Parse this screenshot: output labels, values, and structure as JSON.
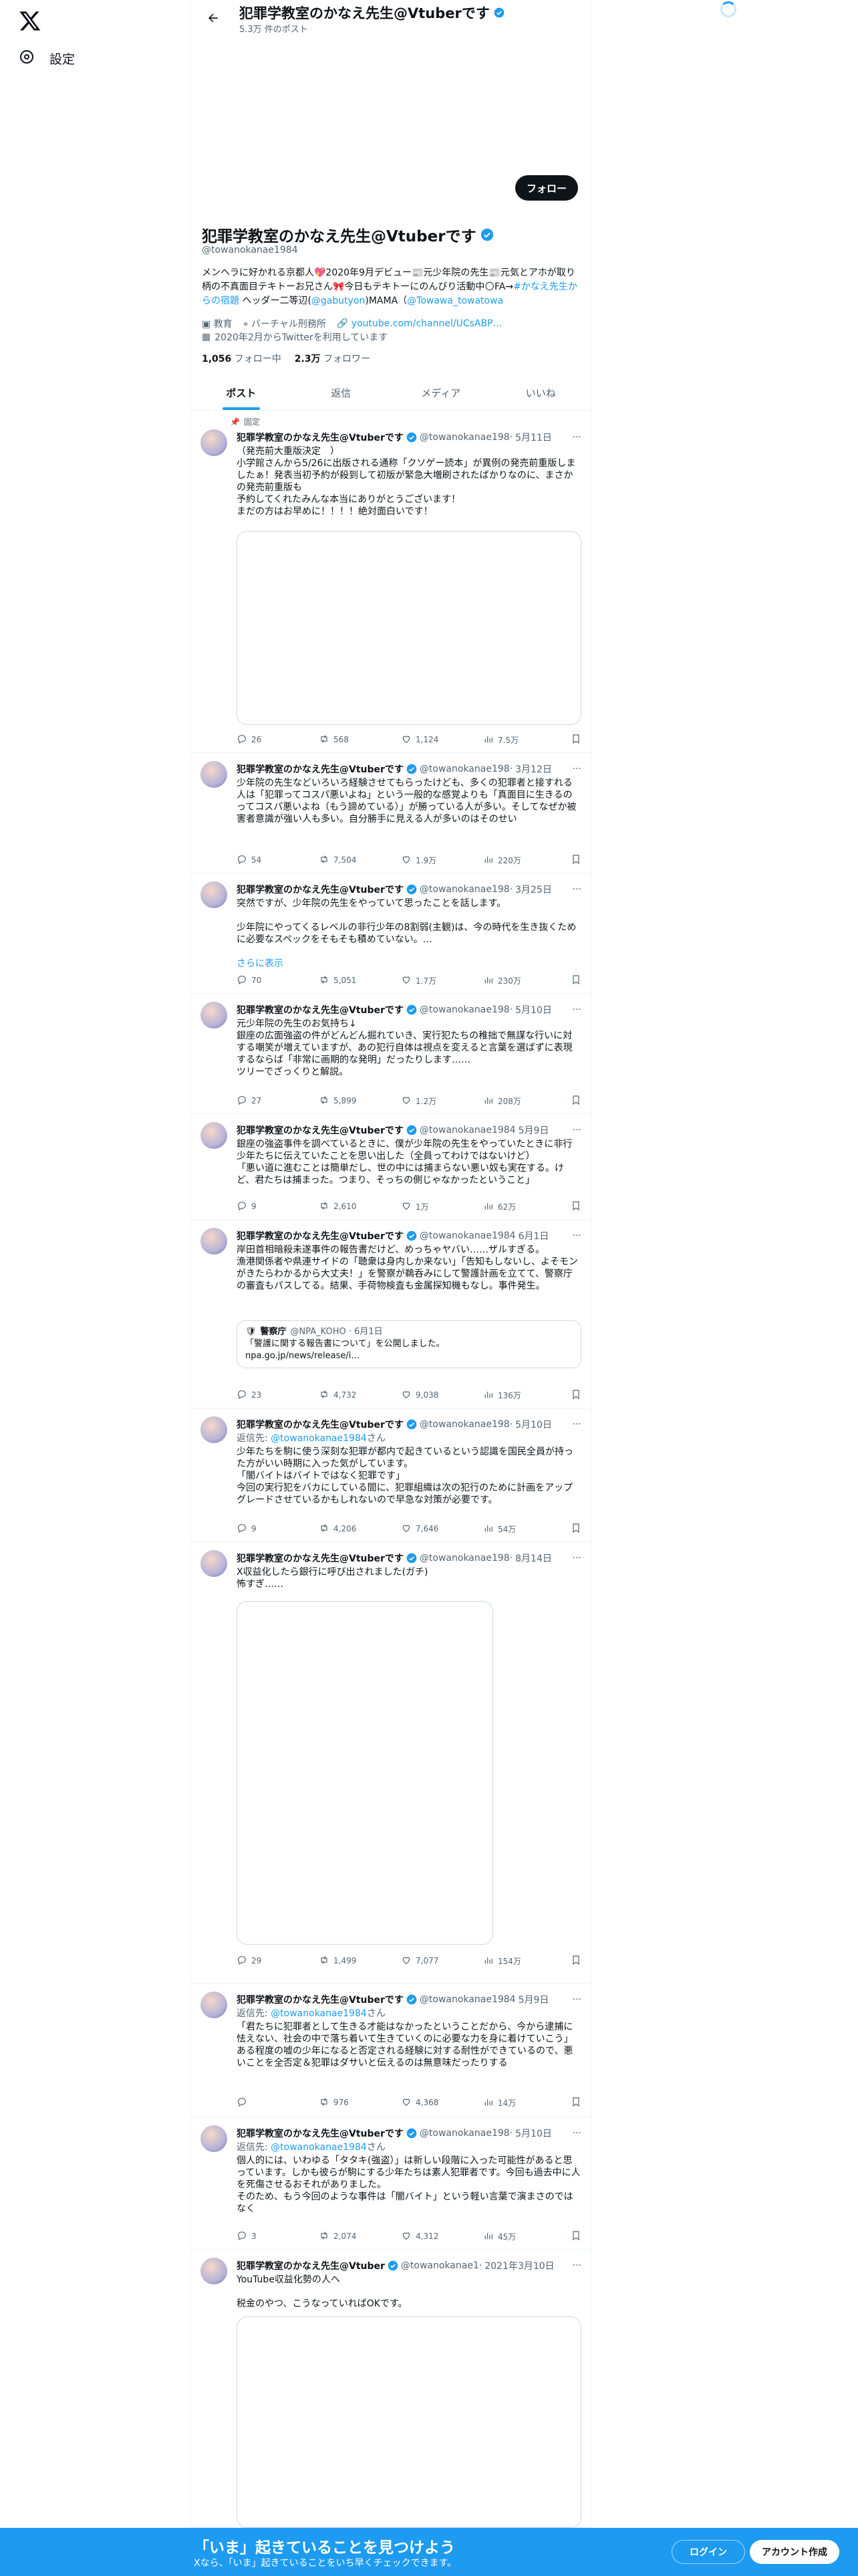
{
  "nav": {
    "settings_label": "設定"
  },
  "header": {
    "title": "犯罪学教室のかなえ先生@Vtuberです",
    "post_count": "5.3万 件のポスト"
  },
  "profile": {
    "follow_label": "フォロー",
    "name": "犯罪学教室のかなえ先生@Vtuberです",
    "handle": "@towanokanae1984",
    "bio_1": "メンヘラに好かれる京都人💖2020年9月デビュー📰元少年院の先生📰元気とアホが取り柄の不真面目テキトーお兄さん🎀今日もテキトーにのんびり活動中🌕FA→",
    "bio_link1": "#かなえ先生からの宿題",
    "bio_2": " ヘッダー二等辺(",
    "bio_link2": "@gabutyon",
    "bio_3": ")MAMA（",
    "bio_link3": "@Towawa_towatowa",
    "meta_category": "教育",
    "meta_location": "バーチャル刑務所",
    "meta_link": "youtube.com/channel/UCsABP…",
    "meta_joined": "2020年2月からTwitterを利用しています",
    "following_count": "1,056",
    "following_label": "フォロー中",
    "followers_count": "2.3万",
    "followers_label": "フォロワー"
  },
  "tabs": [
    "ポスト",
    "返信",
    "メディア",
    "いいね"
  ],
  "pinned_label": "固定",
  "tweets": [
    {
      "name": "犯罪学教室のかなえ先生@Vtuberです",
      "handle": "@towanokanae198·",
      "date": "5月11日",
      "text": "（発売前大重版決定　）\n小学館さんから5/26に出版される通称「クソゲー読本」が異例の発売前重版しましたぁ！発表当初予約が殺到して初版が緊急大増刷されたばかりなのに、まさかの発売前重版も\n予約してくれたみんな本当にありがとうございます！\nまだの方はお早めに！！！！絶対面白いです！",
      "replies": "26",
      "retweets": "568",
      "likes": "1,124",
      "views": "7.5万"
    },
    {
      "name": "犯罪学教室のかなえ先生@Vtuberです",
      "handle": "@towanokanae198·",
      "date": "3月12日",
      "text": "少年院の先生などいろいろ経験させてもらったけども、多くの犯罪者と接すれる人は「犯罪ってコスパ悪いよね」という一般的な感覚よりも「真面目に生きるのってコスパ悪いよね（もう諦めている）」が勝っている人が多い。そしてなぜか被害者意識が強い人も多い。自分勝手に見える人が多いのはそのせい",
      "replies": "54",
      "retweets": "7,504",
      "likes": "1.9万",
      "views": "220万"
    },
    {
      "name": "犯罪学教室のかなえ先生@Vtuberです",
      "handle": "@towanokanae198·",
      "date": "3月25日",
      "text": "突然ですが、少年院の先生をやっていて思ったことを話します。\n\n少年院にやってくるレベルの非行少年の8割弱(主観)は、今の時代を生き抜くために必要なスペックをそもそも積めていない。…",
      "show_more": "さらに表示",
      "replies": "70",
      "retweets": "5,051",
      "likes": "1.7万",
      "views": "230万"
    },
    {
      "name": "犯罪学教室のかなえ先生@Vtuberです",
      "handle": "@towanokanae198·",
      "date": "5月10日",
      "text": "元少年院の先生のお気持ち↓\n銀座の広面強盗の件がどんどん掘れていき、実行犯たちの稚拙で無謀な行いに対する嘲笑が増えていますが、あの犯行自体は視点を変えると言葉を選ばずに表現するならば「非常に画期的な発明」だったりします……\nツリーでざっくりと解説。",
      "replies": "27",
      "retweets": "5,899",
      "likes": "1.2万",
      "views": "208万"
    },
    {
      "name": "犯罪学教室のかなえ先生@Vtuberです",
      "handle": "@towanokanae1984",
      "date": "5月9日",
      "text": "銀座の強盗事件を調べているときに、僕が少年院の先生をやっていたときに非行少年たちに伝えていたことを思い出した（全員ってわけではないけど）\n「悪い道に進むことは簡単だし、世の中には捕まらない悪い奴も実在する。けど、君たちは捕まった。つまり、そっちの側じゃなかったということ」",
      "replies": "9",
      "retweets": "2,610",
      "likes": "1万",
      "views": "62万"
    },
    {
      "name": "犯罪学教室のかなえ先生@Vtuberです",
      "handle": "@towanokanae1984",
      "date": "6月1日",
      "text": "岸田首相暗殺未遂事件の報告書だけど、めっちゃヤバい……ザルすぎる。\n漁港関係者や県連サイドの「聴衆は身内しか来ない」「告知もしないし、よそモンがきたらわかるから大丈夫！」を警察が鵜呑みにして警護計画を立てて、警察庁の審査もパスしてる。結果、手荷物検査も金属探知機もなし。事件発生。",
      "quote_name": "警察庁",
      "quote_meta": "@NPA_KOHO · 6月1日",
      "quote_text": "「警護に関する報告書について」を公開しました。\nnpa.go.jp/news/release/i…",
      "replies": "23",
      "retweets": "4,732",
      "likes": "9,038",
      "views": "136万"
    },
    {
      "name": "犯罪学教室のかなえ先生@Vtuberです",
      "handle": "@towanokanae198·",
      "date": "5月10日",
      "reply_label": "返信先: ",
      "reply_handle": "@towanokanae1984",
      "reply_suffix": "さん",
      "text": "少年たちを駒に使う深刻な犯罪が都内で起きているという認識を国民全員が持った方がいい時期に入った気がしています。\n「闇バイトはバイトではなく犯罪です」\n今回の実行犯をバカにしている間に、犯罪組織は次の犯行のために計画をアップグレードさせているかもしれないので早急な対策が必要です。",
      "replies": "9",
      "retweets": "4,206",
      "likes": "7,646",
      "views": "54万"
    },
    {
      "name": "犯罪学教室のかなえ先生@Vtuberです",
      "handle": "@towanokanae198·",
      "date": "8月14日",
      "text": "X収益化したら銀行に呼び出されました(ガチ)\n怖すぎ……",
      "replies": "29",
      "retweets": "1,499",
      "likes": "7,077",
      "views": "154万"
    },
    {
      "name": "犯罪学教室のかなえ先生@Vtuberです",
      "handle": "@towanokanae1984",
      "date": "5月9日",
      "reply_label": "返信先: ",
      "reply_handle": "@towanokanae1984",
      "reply_suffix": "さん",
      "text": "「君たちに犯罪者として生きる才能はなかったということだから、今から逮捕に怯えない、社会の中で落ち着いて生きていくのに必要な力を身に着けていこう」　ある程度の嘘の少年になると否定される経験に対する耐性ができているので、悪いことを全否定＆犯罪はダサいと伝えるのは無意味だったりする",
      "replies": "",
      "retweets": "976",
      "likes": "4,368",
      "views": "14万"
    },
    {
      "name": "犯罪学教室のかなえ先生@Vtuberです",
      "handle": "@towanokanae198·",
      "date": "5月10日",
      "reply_label": "返信先: ",
      "reply_handle": "@towanokanae1984",
      "reply_suffix": "さん",
      "text": "個人的には、いわゆる「タタキ(強盗）」は新しい段階に入った可能性があると思っています。しかも彼らが駒にする少年たちは素人犯罪者です。今回も過去中に人を死傷させるおそれがありました。\nそのため、もう今回のような事件は「闇バイト」という軽い言葉で演まさのではなく",
      "replies": "3",
      "retweets": "2,074",
      "likes": "4,312",
      "views": "45万"
    },
    {
      "name": "犯罪学教室のかなえ先生@Vtuber",
      "handle": "@towanokanae1·",
      "date": "2021年3月10日",
      "text": "YouTube収益化勢の人へ\n\n税金のやつ、こうなっていればOKです。",
      "replies": "",
      "retweets": "",
      "likes": "",
      "views": ""
    }
  ],
  "bottom": {
    "title": "「いま」起きていることを見つけよう",
    "subtitle": "Xなら、「いま」起きていることをいち早くチェックできます。",
    "login_label": "ログイン",
    "signup_label": "アカウント作成"
  },
  "colors": {
    "accent": "#1d9bf0",
    "text": "#0f1419",
    "muted": "#536471",
    "border": "#eff3f4"
  }
}
